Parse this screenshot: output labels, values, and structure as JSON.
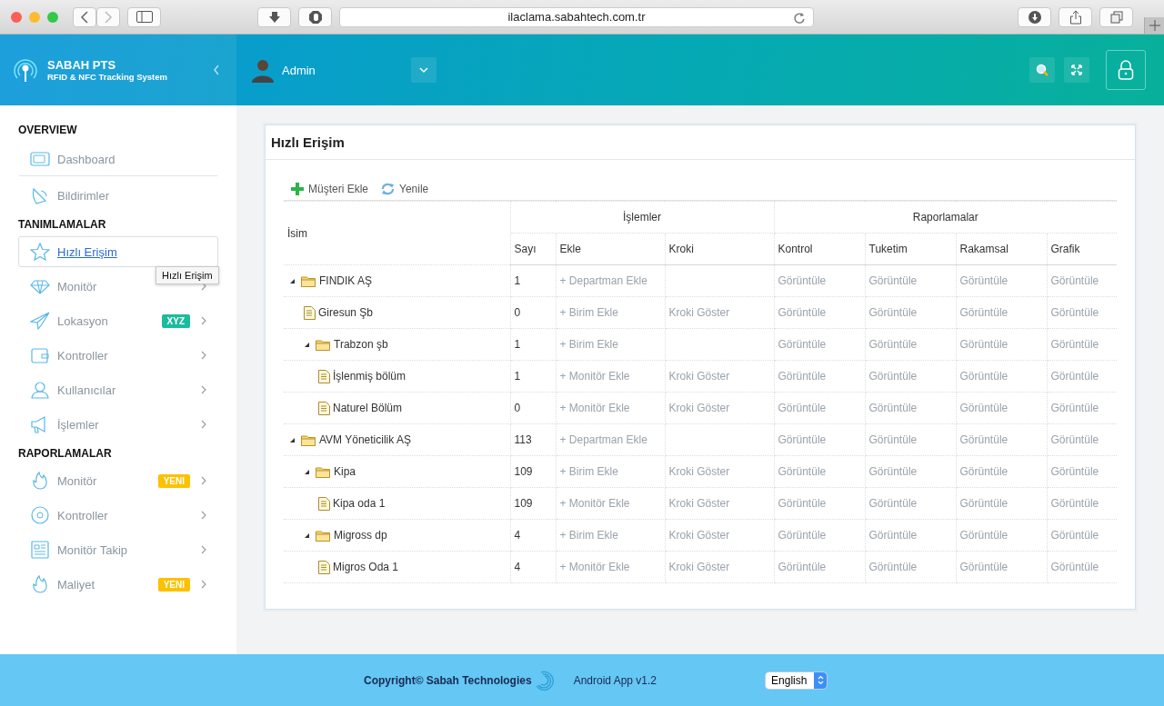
{
  "browser": {
    "url": "ilaclama.sabahtech.com.tr"
  },
  "brand": {
    "title": "SABAH PTS",
    "subtitle": "RFID & NFC Tracking System"
  },
  "header": {
    "user": "Admin"
  },
  "sidebar": {
    "sections": [
      {
        "title": "OVERVIEW",
        "items": [
          {
            "label": "Dashboard",
            "selected": false,
            "expandable": false
          },
          {
            "label": "Bildirimler",
            "selected": false,
            "expandable": false
          }
        ]
      },
      {
        "title": "TANIMLAMALAR",
        "items": [
          {
            "label": "Hızlı Erişim",
            "selected": true,
            "expandable": false
          },
          {
            "label": "Monitör",
            "selected": false,
            "expandable": true
          },
          {
            "label": "Lokasyon",
            "selected": false,
            "expandable": true,
            "badge": {
              "text": "XYZ",
              "color": "#1abc9c"
            }
          },
          {
            "label": "Kontroller",
            "selected": false,
            "expandable": true
          },
          {
            "label": "Kullanıcılar",
            "selected": false,
            "expandable": true
          },
          {
            "label": "İşlemler",
            "selected": false,
            "expandable": true
          }
        ]
      },
      {
        "title": "RAPORLAMALAR",
        "items": [
          {
            "label": "Monitör",
            "selected": false,
            "expandable": true,
            "badge": {
              "text": "YENI",
              "color": "#fcc100"
            }
          },
          {
            "label": "Kontroller",
            "selected": false,
            "expandable": true
          },
          {
            "label": "Monitör Takip",
            "selected": false,
            "expandable": true
          },
          {
            "label": "Maliyet",
            "selected": false,
            "expandable": true,
            "badge": {
              "text": "YENI",
              "color": "#fcc100"
            }
          }
        ]
      }
    ]
  },
  "tooltip": "Hızlı Erişim",
  "panel": {
    "title": "Hızlı Erişim",
    "actions": [
      "Müşteri Ekle",
      "Yenile"
    ],
    "table": {
      "name_header": "İsim",
      "groups": [
        {
          "title": "İşlemler",
          "columns": [
            "Sayı",
            "Ekle",
            "Kroki"
          ]
        },
        {
          "title": "Raporlamalar",
          "columns": [
            "Kontrol",
            "Tuketim",
            "Rakamsal",
            "Grafik"
          ]
        }
      ],
      "rows": [
        {
          "name": "FINDIK AŞ",
          "kind": "folder",
          "expanded": true,
          "count": "1",
          "add": "+ Departman Ekle",
          "reports": [
            "Görüntüle",
            "Görüntüle",
            "Görüntüle",
            "Görüntüle"
          ],
          "children": [
            {
              "name": "Giresun Şb",
              "kind": "file",
              "count": "0",
              "add": "+ Birim Ekle",
              "sketch": "Kroki Göster",
              "reports": [
                "Görüntüle",
                "Görüntüle",
                "Görüntüle",
                "Görüntüle"
              ]
            },
            {
              "name": "Trabzon şb",
              "kind": "folder",
              "expanded": true,
              "count": "1",
              "add": "+ Birim Ekle",
              "reports": [
                "Görüntüle",
                "Görüntüle",
                "Görüntüle",
                "Görüntüle"
              ],
              "children": [
                {
                  "name": "İşlenmiş bölüm",
                  "kind": "file",
                  "count": "1",
                  "add": "+ Monitör Ekle",
                  "sketch": "Kroki Göster",
                  "reports": [
                    "Görüntüle",
                    "Görüntüle",
                    "Görüntüle",
                    "Görüntüle"
                  ]
                },
                {
                  "name": "Naturel Bölüm",
                  "kind": "file",
                  "count": "0",
                  "add": "+ Monitör Ekle",
                  "sketch": "Kroki Göster",
                  "reports": [
                    "Görüntüle",
                    "Görüntüle",
                    "Görüntüle",
                    "Görüntüle"
                  ]
                }
              ]
            }
          ]
        },
        {
          "name": "AVM Yöneticilik AŞ",
          "kind": "folder",
          "expanded": true,
          "count": "113",
          "add": "+ Departman Ekle",
          "reports": [
            "Görüntüle",
            "Görüntüle",
            "Görüntüle",
            "Görüntüle"
          ],
          "children": [
            {
              "name": "Kipa",
              "kind": "folder",
              "expanded": true,
              "count": "109",
              "add": "+ Birim Ekle",
              "sketch": "Kroki Göster",
              "reports": [
                "Görüntüle",
                "Görüntüle",
                "Görüntüle",
                "Görüntüle"
              ],
              "children": [
                {
                  "name": "Kipa oda 1",
                  "kind": "file",
                  "count": "109",
                  "add": "+ Monitör Ekle",
                  "sketch": "Kroki Göster",
                  "reports": [
                    "Görüntüle",
                    "Görüntüle",
                    "Görüntüle",
                    "Görüntüle"
                  ]
                }
              ]
            },
            {
              "name": "Migross dp",
              "kind": "folder",
              "expanded": true,
              "count": "4",
              "add": "+ Birim Ekle",
              "sketch": "Kroki Göster",
              "reports": [
                "Görüntüle",
                "Görüntüle",
                "Görüntüle",
                "Görüntüle"
              ],
              "children": [
                {
                  "name": "Migros Oda 1",
                  "kind": "file",
                  "count": "4",
                  "add": "+ Monitör Ekle",
                  "sketch": "Kroki Göster",
                  "reports": [
                    "Görüntüle",
                    "Görüntüle",
                    "Görüntüle",
                    "Görüntüle"
                  ]
                }
              ]
            }
          ]
        }
      ]
    }
  },
  "footer": {
    "copyright": "Copyright© Sabah Technologies",
    "app": "Android App v1.2",
    "language": "English"
  }
}
